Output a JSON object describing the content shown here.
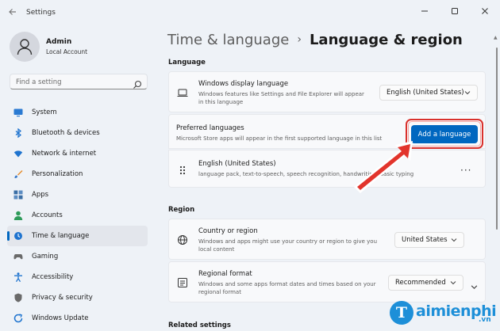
{
  "window": {
    "title": "Settings",
    "minimize_icon": "minimize-icon",
    "maximize_icon": "maximize-icon",
    "close_icon": "close-icon"
  },
  "user": {
    "name": "Admin",
    "account": "Local Account"
  },
  "search": {
    "placeholder": "Find a setting"
  },
  "sidebar": {
    "items": [
      {
        "label": "System",
        "icon": "monitor-icon",
        "color": "#0067c0"
      },
      {
        "label": "Bluetooth & devices",
        "icon": "bluetooth-icon",
        "color": "#0067c0"
      },
      {
        "label": "Network & internet",
        "icon": "wifi-icon",
        "color": "#0067c0"
      },
      {
        "label": "Personalization",
        "icon": "brush-icon",
        "color": "#e08a2c"
      },
      {
        "label": "Apps",
        "icon": "apps-icon",
        "color": "#3a6ea5"
      },
      {
        "label": "Accounts",
        "icon": "person-icon",
        "color": "#2e9b5a"
      },
      {
        "label": "Time & language",
        "icon": "globe-clock-icon",
        "color": "#0067c0"
      },
      {
        "label": "Gaming",
        "icon": "gamepad-icon",
        "color": "#5a5a5a"
      },
      {
        "label": "Accessibility",
        "icon": "accessibility-icon",
        "color": "#0067c0"
      },
      {
        "label": "Privacy & security",
        "icon": "shield-icon",
        "color": "#5a5a5a"
      },
      {
        "label": "Windows Update",
        "icon": "update-icon",
        "color": "#0067c0"
      }
    ],
    "active_index": 6
  },
  "breadcrumb": {
    "parent": "Time & language",
    "separator": "›",
    "current": "Language & region"
  },
  "language_section": {
    "label": "Language",
    "display_language": {
      "title": "Windows display language",
      "description": "Windows features like Settings and File Explorer will appear in this language",
      "value": "English (United States)"
    },
    "preferred": {
      "title": "Preferred languages",
      "description": "Microsoft Store apps will appear in the first supported language in this list",
      "button": "Add a language"
    },
    "installed_language": {
      "title": "English (United States)",
      "description": "language pack, text-to-speech, speech recognition, handwriting, basic typing",
      "more": "···"
    }
  },
  "region_section": {
    "label": "Region",
    "country": {
      "title": "Country or region",
      "description": "Windows and apps might use your country or region to give you local content",
      "value": "United States"
    },
    "format": {
      "title": "Regional format",
      "description": "Windows and some apps format dates and times based on your regional format",
      "value": "Recommended"
    }
  },
  "related": {
    "label": "Related settings"
  },
  "watermark": {
    "letter": "T",
    "brand": "aimienphi",
    "suffix": ".vn"
  },
  "colors": {
    "accent": "#0067c0",
    "annotation": "#d9302c"
  }
}
